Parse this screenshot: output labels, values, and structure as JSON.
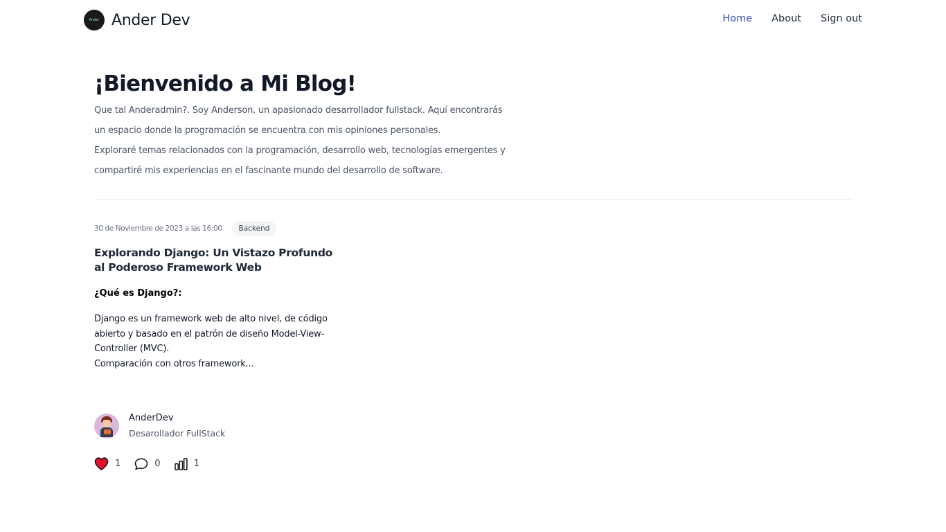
{
  "header": {
    "logo_text": "Ander",
    "brand": "Ander Dev",
    "nav": [
      {
        "label": "Home",
        "active": true
      },
      {
        "label": "About",
        "active": false
      },
      {
        "label": "Sign out",
        "active": false
      }
    ]
  },
  "hero": {
    "title": "¡Bienvenido a Mi Blog!",
    "lines": [
      "Que tal Anderadmin?. Soy Anderson, un apasionado desarrollador fullstack. Aquí encontrarás",
      "un espacio donde la programación se encuentra con mis opiniones personales.",
      "Exploraré temas relacionados con la programación, desarrollo web, tecnologías emergentes y",
      "compartiré mis experiencias en el fascinante mundo del desarrollo de software."
    ]
  },
  "post": {
    "date": "30 de Noviembre de 2023 a las 16:00",
    "tag": "Backend",
    "title": "Explorando Django: Un Vistazo Profundo al Poderoso Framework Web",
    "excerpt_heading": "¿Qué es Django?:",
    "excerpt_lines": [
      "Django es un framework web de alto nivel, de código",
      "abierto y basado en el patrón de diseño Model-View-",
      "Controller (MVC).",
      "Comparación con otros framework..."
    ],
    "author": {
      "name": "AnderDev",
      "role": "Desarollador FullStack"
    },
    "stats": {
      "likes": "1",
      "comments": "0",
      "views": "1"
    }
  },
  "colors": {
    "accent": "#3b4fb8",
    "heart": "#e0112b"
  },
  "icons": [
    "heart-icon",
    "comment-icon",
    "views-chart-icon"
  ]
}
